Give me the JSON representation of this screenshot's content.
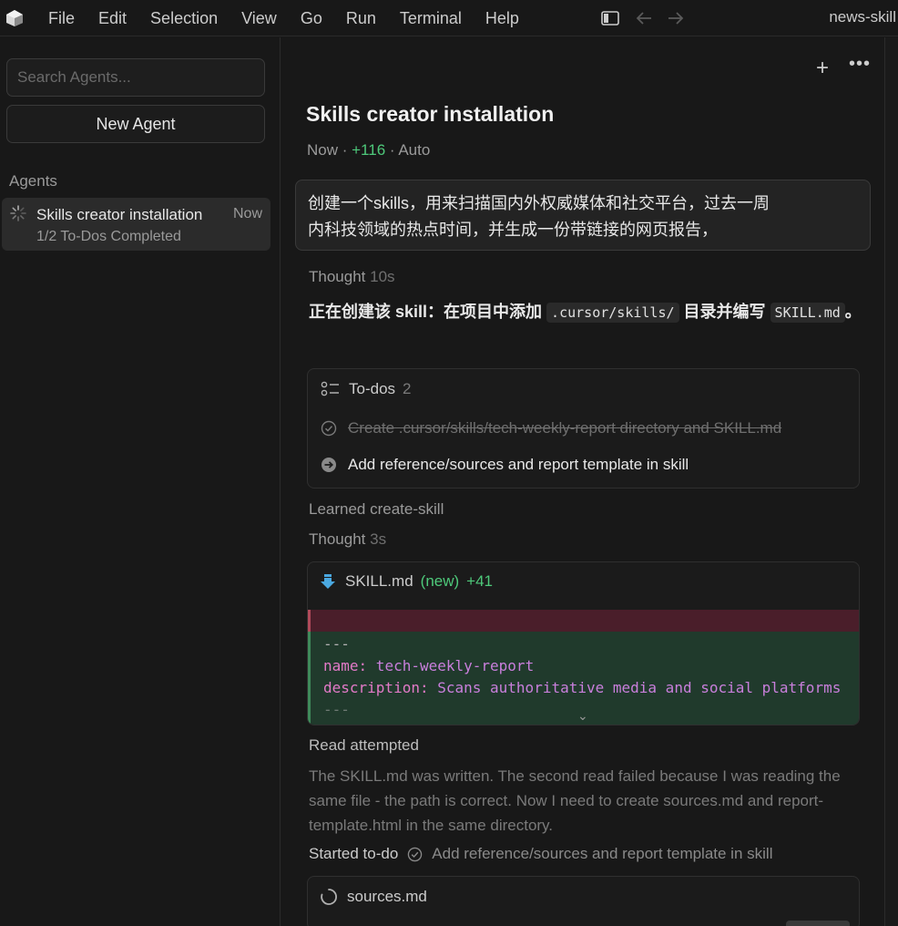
{
  "menu": [
    "File",
    "Edit",
    "Selection",
    "View",
    "Go",
    "Run",
    "Terminal",
    "Help"
  ],
  "window_title": "news-skill",
  "sidebar": {
    "search_placeholder": "Search Agents...",
    "new_agent_label": "New Agent",
    "agents_heading": "Agents",
    "agents": [
      {
        "title": "Skills creator installation",
        "time": "Now",
        "subtitle": "1/2 To-Dos Completed"
      }
    ]
  },
  "chat": {
    "title": "Skills creator installation",
    "meta_time": "Now",
    "meta_changes": "+116",
    "meta_mode": "Auto",
    "user_message": {
      "line1": "创建一个skills，用来扫描国内外权威媒体和社交平台，过去一周",
      "line2": "内科技领域的热点时间，并生成一份带链接的网页报告，"
    },
    "thought1": {
      "label": "Thought",
      "duration": "10s"
    },
    "status": {
      "prefix": "正在创建该 skill：在项目中添加",
      "path": ".cursor/skills/",
      "middle": "目录并编写",
      "file": "SKILL.md",
      "suffix": "。"
    },
    "todos": {
      "label": "To-dos",
      "count": "2",
      "items": [
        {
          "text": "Create .cursor/skills/tech-weekly-report directory and SKILL.md",
          "status": "done"
        },
        {
          "text": "Add reference/sources and report template in skill",
          "status": "in-progress"
        }
      ]
    },
    "learned": "Learned create-skill",
    "thought2": {
      "label": "Thought",
      "duration": "3s"
    },
    "file_edit": {
      "name": "SKILL.md",
      "tag": "(new)",
      "additions": "+41",
      "lines": [
        {
          "text": "---"
        },
        {
          "key": "name:",
          "value": " tech-weekly-report"
        },
        {
          "key": "description:",
          "value": " Scans authoritative media and social platforms"
        },
        {
          "text": "---"
        }
      ]
    },
    "read_attempted": "Read attempted",
    "read_paragraph": "The SKILL.md was written. The second read failed because I was reading the same file - the path is correct. Now I need to create sources.md and report-template.html in the same directory.",
    "started_todo": {
      "label": "Started to-do",
      "item": "Add reference/sources and report template in skill"
    },
    "sources_file": "sources.md"
  }
}
